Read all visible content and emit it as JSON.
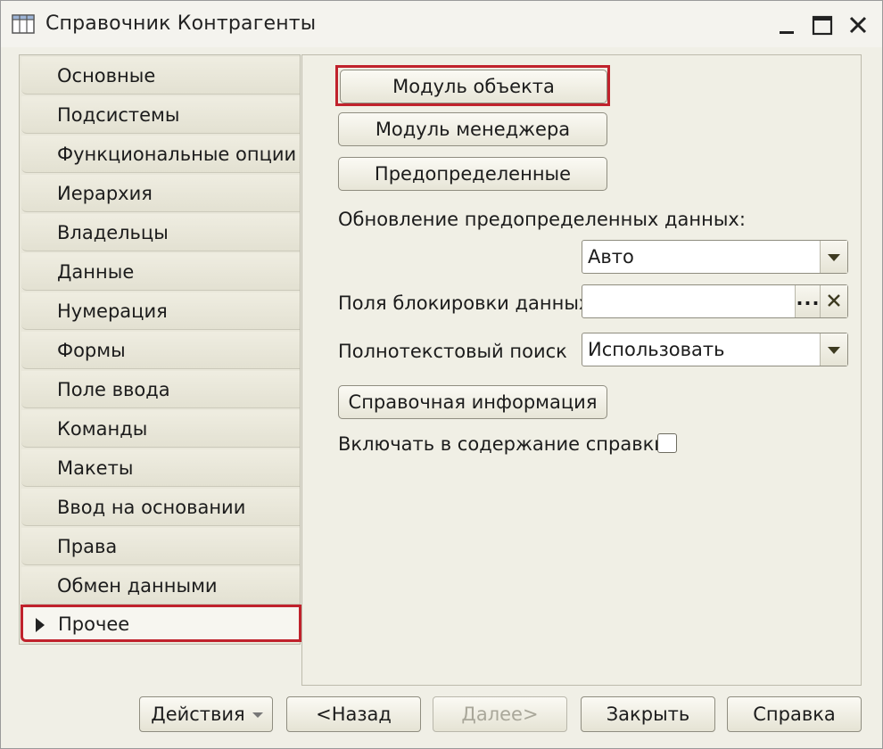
{
  "window": {
    "title": "Справочник Контрагенты"
  },
  "icons": {
    "catalog": "table-icon",
    "minimize": "minimize-icon",
    "maximize": "maximize-icon",
    "close": "close-icon"
  },
  "colors": {
    "highlight": "#c0222c",
    "background": "#f0efe6"
  },
  "nav": {
    "items": [
      {
        "label": "Основные"
      },
      {
        "label": "Подсистемы"
      },
      {
        "label": "Функциональные опции"
      },
      {
        "label": "Иерархия"
      },
      {
        "label": "Владельцы"
      },
      {
        "label": "Данные"
      },
      {
        "label": "Нумерация"
      },
      {
        "label": "Формы"
      },
      {
        "label": "Поле ввода"
      },
      {
        "label": "Команды"
      },
      {
        "label": "Макеты"
      },
      {
        "label": "Ввод на основании"
      },
      {
        "label": "Права"
      },
      {
        "label": "Обмен данными"
      },
      {
        "label": "Прочее",
        "active": true
      }
    ]
  },
  "panel": {
    "object_module_label": "Модуль объекта",
    "manager_module_label": "Модуль менеджера",
    "predefined_label": "Предопределенные",
    "update_predefined_label": "Обновление предопределенных данных:",
    "update_predefined_value": "Авто",
    "lock_fields_label": "Поля блокировки данных",
    "lock_fields_value": "",
    "lock_select_label": "...",
    "fulltext_label": "Полнотекстовый поиск",
    "fulltext_value": "Использовать",
    "help_info_label": "Справочная информация",
    "include_help_label": "Включать в содержание справки",
    "include_help_checked": false
  },
  "footer": {
    "actions_label": "Действия",
    "back_label": "<Назад",
    "next_label": "Далее>",
    "close_label": "Закрыть",
    "help_label": "Справка"
  }
}
